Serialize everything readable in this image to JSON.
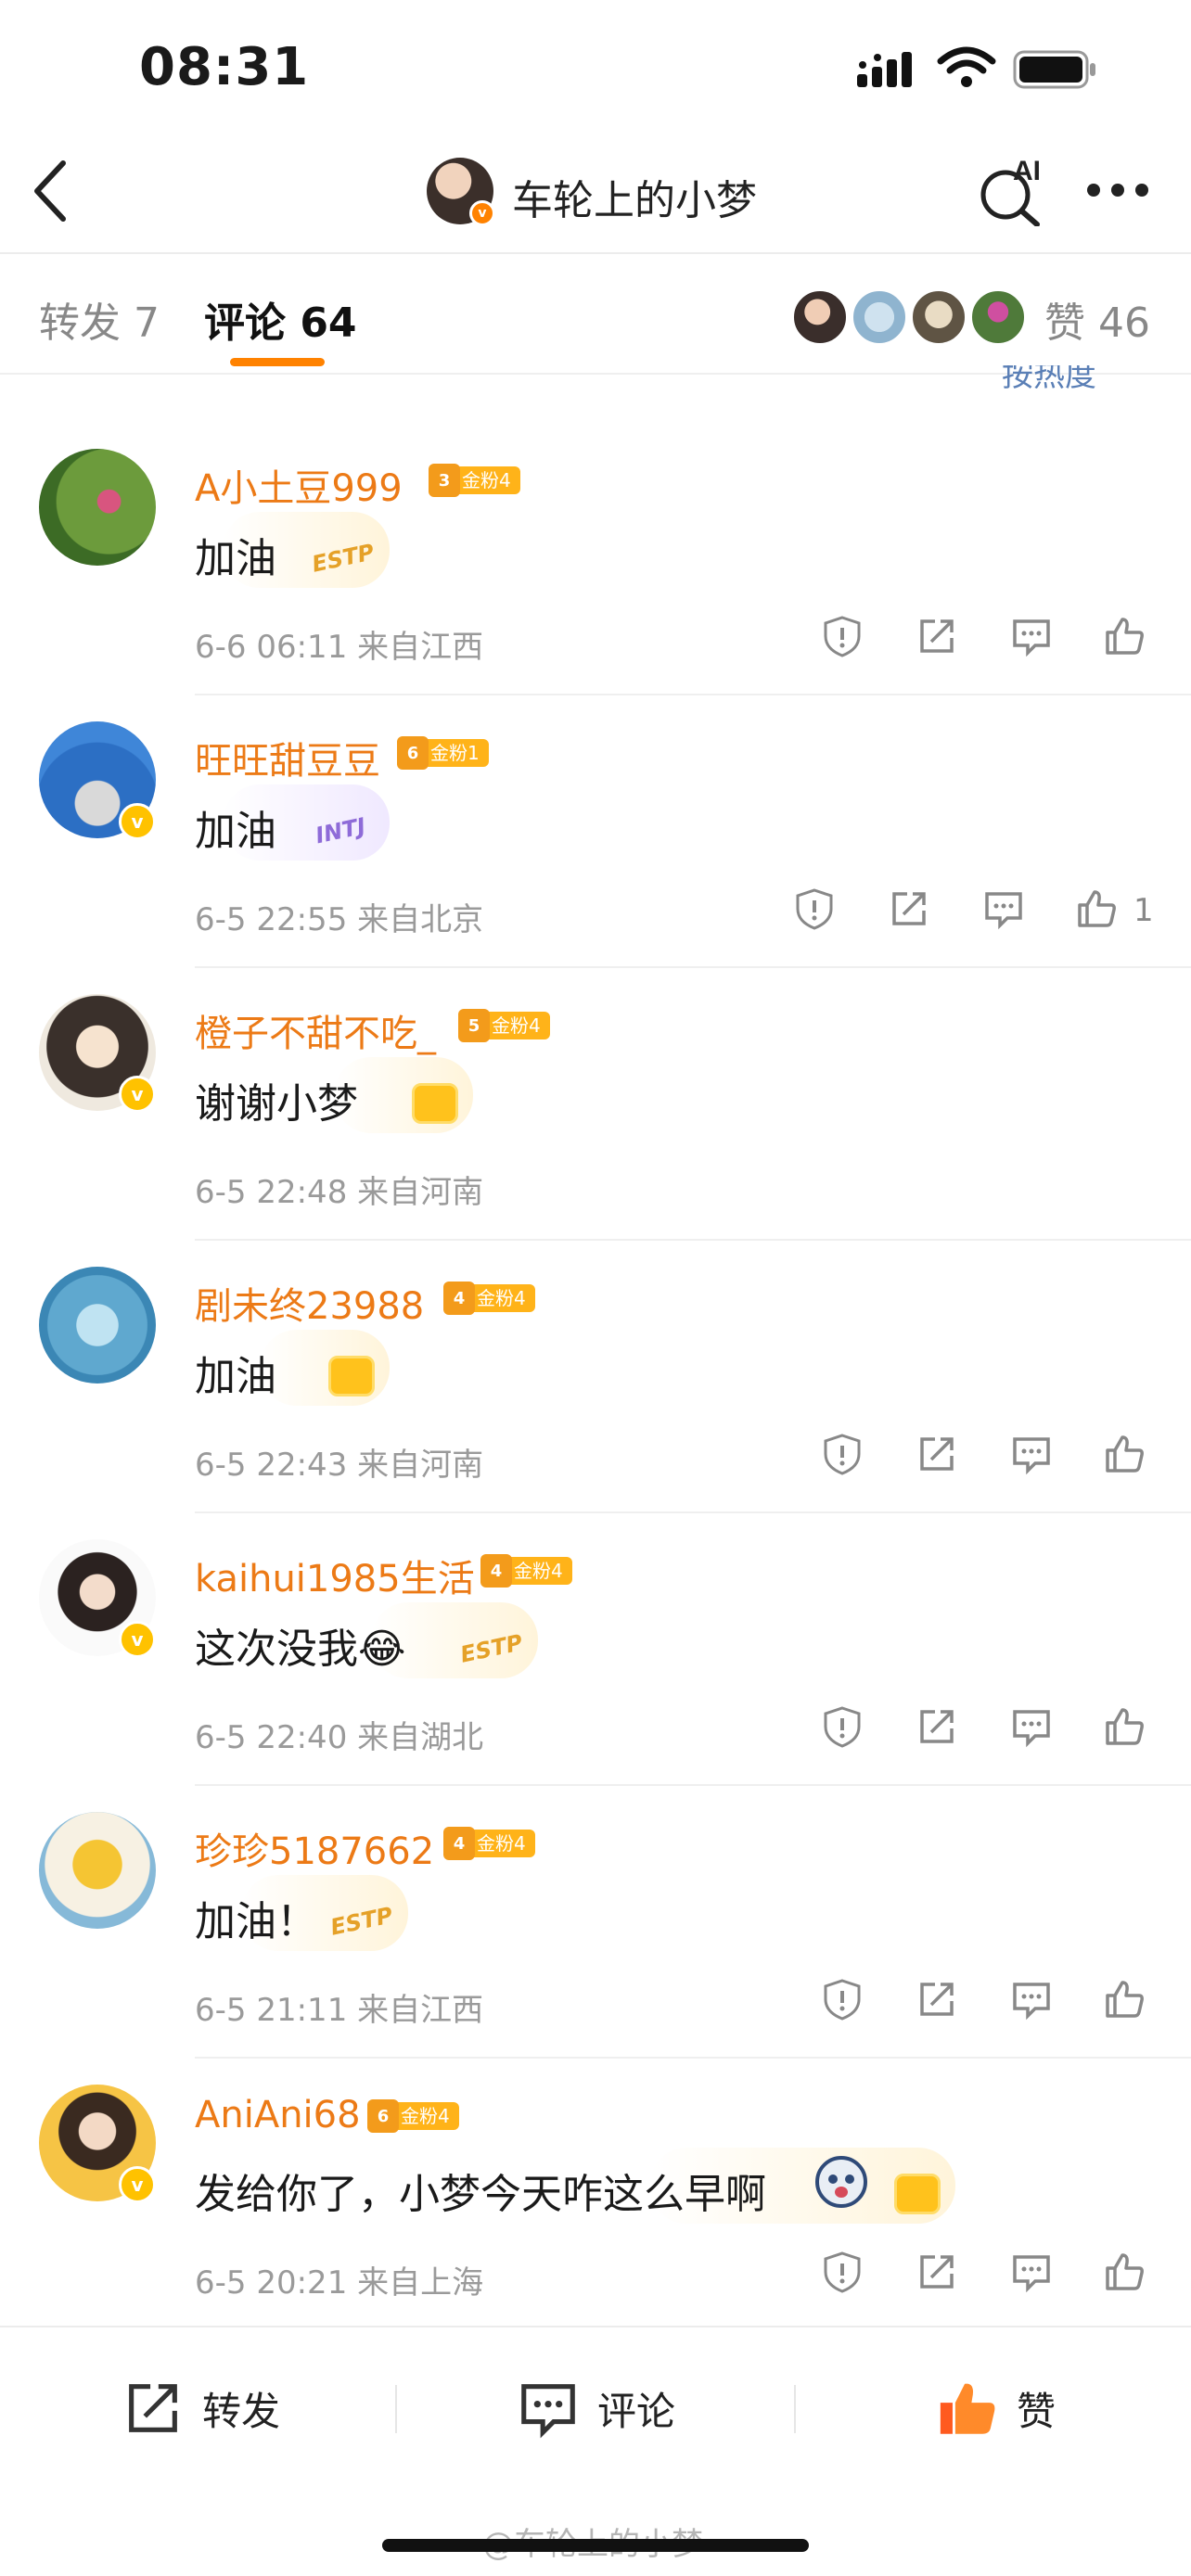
{
  "status": {
    "time": "08:31"
  },
  "nav": {
    "title": "车轮上的小梦",
    "ai_label": "AI"
  },
  "tabs": {
    "repost": "转发 7",
    "comment": "评论 64",
    "likes": "赞 46",
    "sort": "按热度"
  },
  "comments": [
    {
      "name": "A小土豆999",
      "fan_level": "3",
      "fan_label": "金粉4",
      "text": "加油",
      "tag": "ESTP",
      "time": "6-6 06:11",
      "location": "来自江西",
      "likes": ""
    },
    {
      "name": "旺旺甜豆豆",
      "fan_level": "6",
      "fan_label": "金粉1",
      "text": "加油",
      "tag": "INTJ",
      "time": "6-5 22:55",
      "location": "来自北京",
      "likes": "1"
    },
    {
      "name": "橙子不甜不吃_",
      "fan_level": "5",
      "fan_label": "金粉4",
      "text": "谢谢小梦",
      "tag": "",
      "time": "6-5 22:48",
      "location": "来自河南",
      "likes": ""
    },
    {
      "name": "剧未终23988",
      "fan_level": "4",
      "fan_label": "金粉4",
      "text": "加油",
      "tag": "",
      "time": "6-5 22:43",
      "location": "来自河南",
      "likes": ""
    },
    {
      "name": "kaihui1985生活",
      "fan_level": "4",
      "fan_label": "金粉4",
      "text": "这次没我😂",
      "tag": "ESTP",
      "time": "6-5 22:40",
      "location": "来自湖北",
      "likes": ""
    },
    {
      "name": "珍珍5187662",
      "fan_level": "4",
      "fan_label": "金粉4",
      "text": "加油！",
      "tag": "ESTP",
      "time": "6-5 21:11",
      "location": "来自江西",
      "likes": ""
    },
    {
      "name": "AniAni68",
      "fan_level": "6",
      "fan_label": "金粉4",
      "text": "发给你了，小梦今天咋这么早啊",
      "tag": "",
      "time": "6-5 20:21",
      "location": "来自上海",
      "likes": ""
    }
  ],
  "bottom": {
    "repost": "转发",
    "comment": "评论",
    "like": "赞"
  },
  "watermark": "@车轮上的小梦",
  "colors": {
    "accent": "#ff8200",
    "name": "#ec7a16",
    "like_active": "#ff5a1f"
  },
  "icons": [
    "back-icon",
    "ai-search-icon",
    "more-icon",
    "report-icon",
    "share-icon",
    "reply-icon",
    "like-icon"
  ]
}
